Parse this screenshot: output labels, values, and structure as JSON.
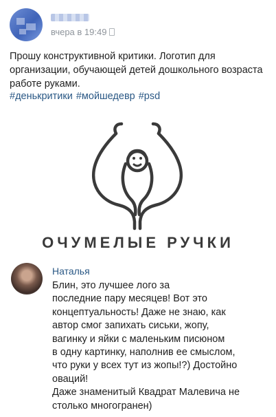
{
  "post": {
    "time": "вчера в 19:49",
    "text": "Прошу конструктивной критики. Логотип для организации, обучающей детей дошкольного возраста работе руками.",
    "hashtags": [
      "#денькритики",
      "#мойшедевр",
      "#psd"
    ]
  },
  "logo": {
    "text": "ОЧУМЕЛЫЕ РУЧКИ",
    "stroke_color": "#3a3a3a"
  },
  "comment": {
    "author": "Наталья",
    "text": "Блин, это лучшее лого за\nпоследние пару месяцев! Вот это\nконцептуальность! Даже не знаю, как\nавтор смог запихать сиськи, жопу,\nвагинку и яйки с маленьким писюном\nв одну картинку, наполнив ее смыслом,\nчто руки у всех тут из жопы!?) Достойно\nоваций!\nДаже знаменитый Квадрат Малевича не\nстолько многогранен)"
  },
  "colors": {
    "link": "#2a5885",
    "muted": "#8e949b",
    "text": "#1f1f1f"
  }
}
